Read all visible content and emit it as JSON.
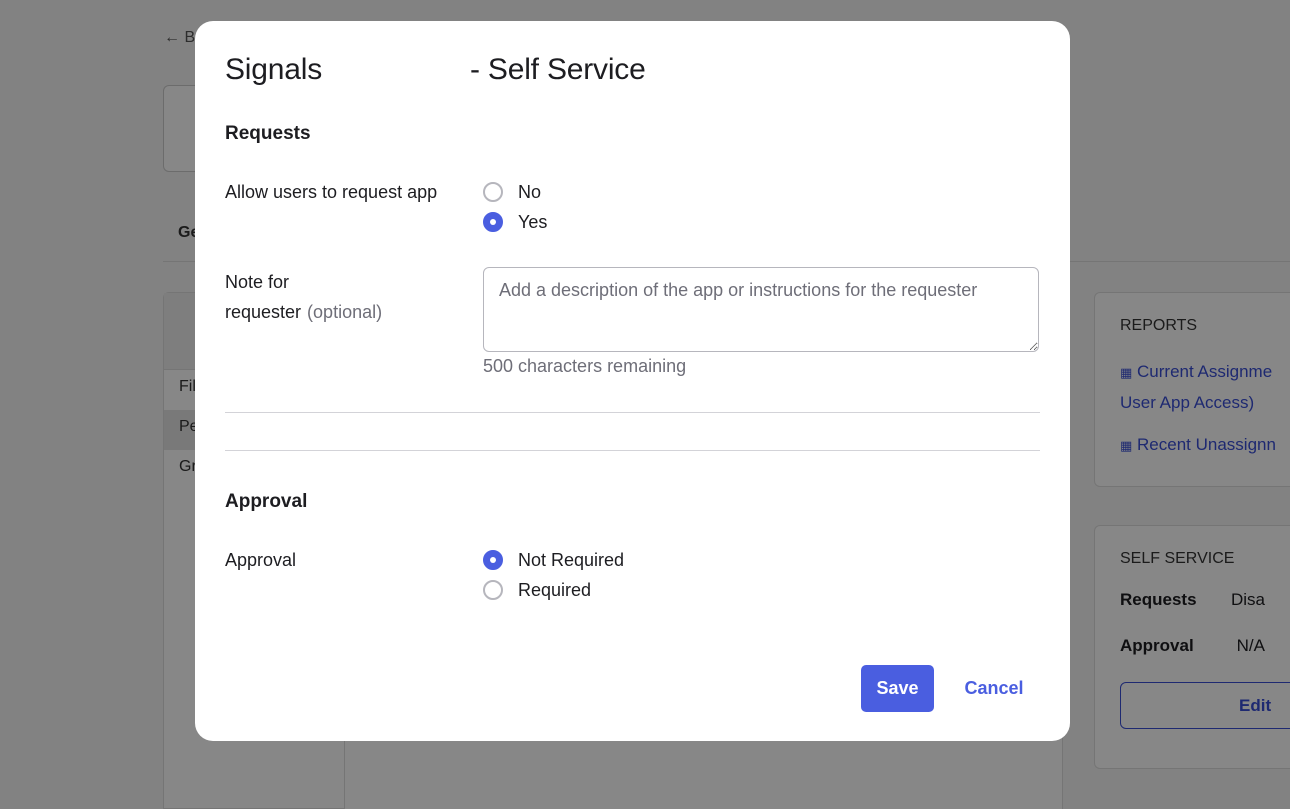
{
  "background": {
    "back_link": "← B",
    "tab_partial": "Ge",
    "left_panel_items": [
      "Fil",
      "Pe",
      "Gr"
    ],
    "reports": {
      "caption": "REPORTS",
      "link1_line1": "Current Assignme",
      "link1_line2": "User App Access)",
      "link2": "Recent Unassignn"
    },
    "self_service": {
      "caption": "SELF SERVICE",
      "requests_label": "Requests",
      "requests_value": "Disa",
      "approval_label": "Approval",
      "approval_value": "N/A",
      "edit_label": "Edit"
    }
  },
  "modal": {
    "title_app": "Signals",
    "title_suffix": "- Self Service",
    "requests_section": {
      "title": "Requests",
      "allow_label": "Allow users to request app",
      "options": [
        {
          "label": "No",
          "checked": false
        },
        {
          "label": "Yes",
          "checked": true
        }
      ],
      "note_label_line1": "Note for",
      "note_label_line2": "requester",
      "note_optional": "(optional)",
      "note_placeholder": "Add a description of the app or instructions for the requester",
      "note_value": "",
      "chars_remaining": "500 characters remaining"
    },
    "approval_section": {
      "title": "Approval",
      "approval_label": "Approval",
      "options": [
        {
          "label": "Not Required",
          "checked": true
        },
        {
          "label": "Required",
          "checked": false
        }
      ]
    },
    "save_label": "Save",
    "cancel_label": "Cancel"
  },
  "colors": {
    "accent": "#4a5ee0",
    "overlay": "rgba(0,0,0,0.47)"
  }
}
